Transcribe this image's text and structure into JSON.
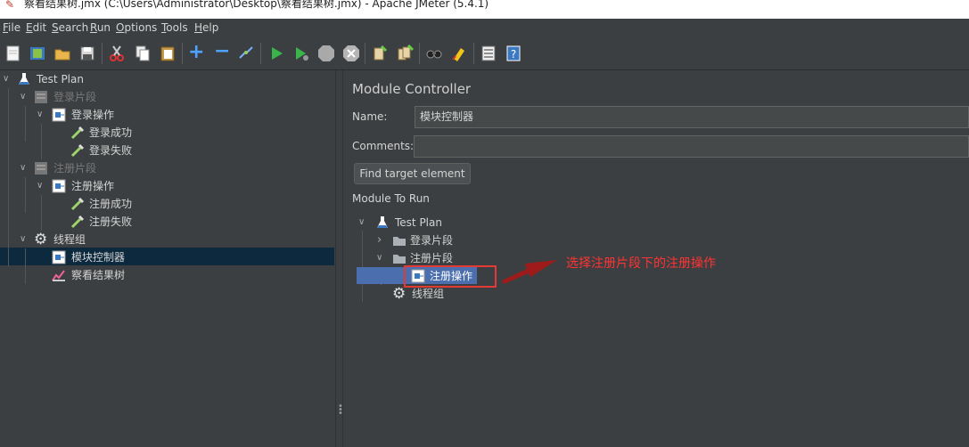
{
  "window": {
    "title": "察看结果树.jmx (C:\\Users\\Administrator\\Desktop\\察看结果树.jmx) - Apache JMeter (5.4.1)"
  },
  "menubar": {
    "items": [
      {
        "label": "File",
        "key": "F",
        "rest": "ile"
      },
      {
        "label": "Edit",
        "key": "E",
        "rest": "dit"
      },
      {
        "label": "Search",
        "key": "S",
        "rest": "earch"
      },
      {
        "label": "Run",
        "key": "R",
        "rest": "un"
      },
      {
        "label": "Options",
        "key": "O",
        "rest": "ptions"
      },
      {
        "label": "Tools",
        "key": "T",
        "rest": "ools"
      },
      {
        "label": "Help",
        "key": "H",
        "rest": "elp"
      }
    ]
  },
  "toolbar": {
    "icons": [
      "new-icon",
      "templates-icon",
      "open-icon",
      "save-icon",
      "cut-icon",
      "copy-icon",
      "paste-icon",
      "expand-icon",
      "collapse-icon",
      "toggle-icon",
      "start-icon",
      "start-no-pause-icon",
      "stop-icon",
      "shutdown-icon",
      "clear-icon",
      "clear-all-icon",
      "search-icon",
      "reset-search-icon",
      "function-helper-icon",
      "help-icon"
    ]
  },
  "tree": {
    "nodes": [
      {
        "label": "Test Plan",
        "icon": "flask-icon",
        "enabled": true
      },
      {
        "label": "登录片段",
        "icon": "fragment-icon",
        "enabled": false
      },
      {
        "label": "登录操作",
        "icon": "module-icon",
        "enabled": true
      },
      {
        "label": "登录成功",
        "icon": "pipette-icon",
        "enabled": true
      },
      {
        "label": "登录失败",
        "icon": "pipette-icon",
        "enabled": true
      },
      {
        "label": "注册片段",
        "icon": "fragment-icon",
        "enabled": false
      },
      {
        "label": "注册操作",
        "icon": "module-icon",
        "enabled": true
      },
      {
        "label": "注册成功",
        "icon": "pipette-icon",
        "enabled": true
      },
      {
        "label": "注册失败",
        "icon": "pipette-icon",
        "enabled": true
      },
      {
        "label": "线程组",
        "icon": "gear-icon",
        "enabled": true
      },
      {
        "label": "模块控制器",
        "icon": "module-icon",
        "enabled": true,
        "selected": true
      },
      {
        "label": "察看结果树",
        "icon": "results-tree-icon",
        "enabled": true
      }
    ]
  },
  "panel": {
    "title": "Module Controller",
    "name_label": "Name:",
    "name_value": "模块控制器",
    "comments_label": "Comments:",
    "comments_value": "",
    "find_button": "Find target element",
    "module_label": "Module To Run",
    "module_tree": [
      {
        "label": "Test Plan",
        "icon": "flask-icon"
      },
      {
        "label": "登录片段",
        "icon": "folder-icon"
      },
      {
        "label": "注册片段",
        "icon": "folder-icon"
      },
      {
        "label": "注册操作",
        "icon": "module-icon",
        "selected": true
      },
      {
        "label": "线程组",
        "icon": "gear-icon"
      }
    ]
  },
  "annotation": {
    "text": "选择注册片段下的注册操作",
    "color": "#ff3333"
  },
  "colors": {
    "background": "#3c3f41",
    "selection": "#0d293e",
    "highlight": "#4b6eaf",
    "annotation": "#e53935"
  }
}
